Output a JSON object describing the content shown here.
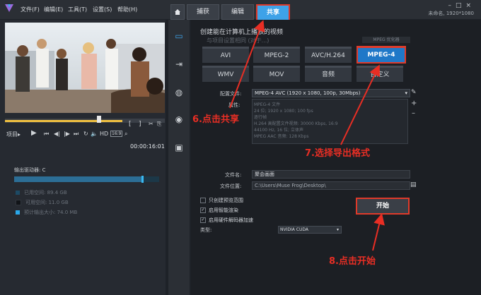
{
  "menu": {
    "items": [
      "文件(F)",
      "编辑(E)",
      "工具(T)",
      "设置(S)",
      "帮助(H)"
    ]
  },
  "tabs": {
    "home_icon": "home-icon",
    "capture": "捕获",
    "edit": "编辑",
    "share": "共享"
  },
  "project": {
    "name": "未命名, 1920*1080"
  },
  "player": {
    "mode_label": "项目▸",
    "timecode": "00:00:16:01",
    "hd_label": "HD",
    "ratio_label": "16:9"
  },
  "drive": {
    "title": "输出驱动器: C",
    "legend": [
      {
        "label": "已用空间:",
        "value": "89.4 GB",
        "color": "#1d4a64"
      },
      {
        "label": "可用空间:",
        "value": "11.0 GB",
        "color": "#1b1f25"
      },
      {
        "label": "预计输出大小:",
        "value": "74.0 MB",
        "color": "#2aa8ea"
      }
    ],
    "used_fraction": 0.89
  },
  "share": {
    "section_title": "创建能在计算机上播放的视频",
    "subsetting": "与项目设置相同 (对于...)",
    "mpeg_option": "MPEG 优化器",
    "formats": [
      "AVI",
      "MPEG-2",
      "AVC/H.264",
      "MPEG-4",
      "WMV",
      "MOV",
      "音频",
      "自定义"
    ],
    "profile_label": "配置文件:",
    "profile_value": "MPEG-4 AVC (1920 x 1080, 100p, 30Mbps)",
    "props_label": "属性:",
    "props": [
      "MPEG-4 文件",
      "24 位; 1920 x 1080; 100 fps",
      "逐行帧",
      "H.264 高配置文件视频: 30000 Kbps, 16:9",
      "44100 Hz, 16 位; 立体声",
      "MPEG AAC 音频: 128 Kbps"
    ],
    "filename_label": "文件名:",
    "filename_value": "聚会画面",
    "path_label": "文件位置:",
    "path_value": "C:\\Users\\Muse Frog\\Desktop\\",
    "options": [
      {
        "label": "只创建预览范围",
        "checked": false
      },
      {
        "label": "启用智能渲染",
        "checked": true
      },
      {
        "label": "启用硬件解码器加速",
        "checked": true
      }
    ],
    "type_label": "类型:",
    "type_value": "NVIDIA CUDA",
    "start_button": "开始"
  },
  "annotations": {
    "step6": "6.点击共享",
    "step7": "7.选择导出格式",
    "step8": "8.点击开始",
    "color": "#e82e24"
  }
}
